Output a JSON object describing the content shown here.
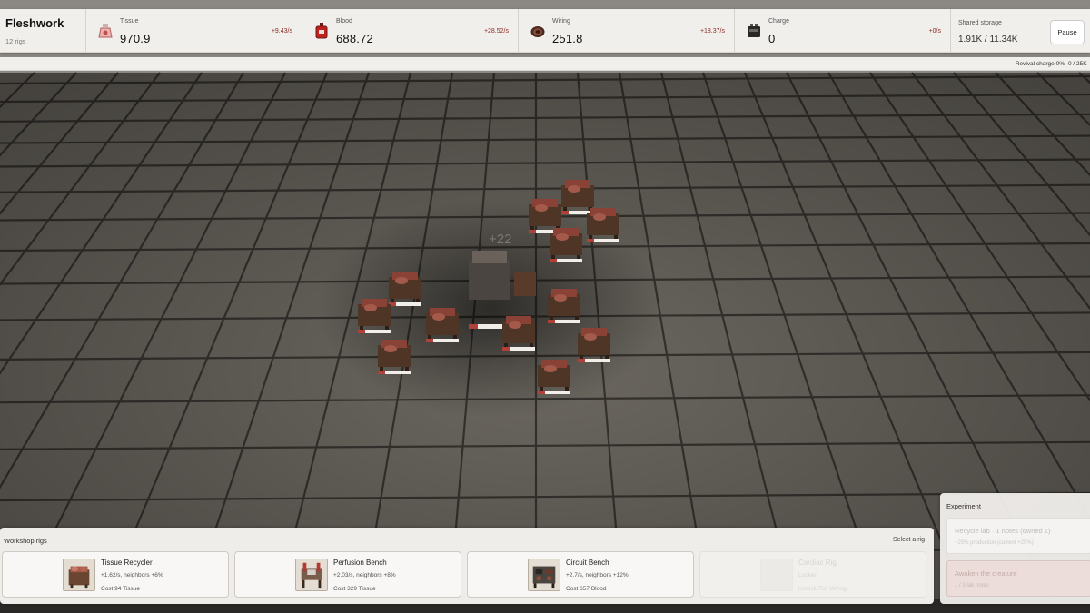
{
  "header": {
    "title": "Fleshwork",
    "rig_count": "12 rigs"
  },
  "resources": [
    {
      "name": "Tissue",
      "value": "970.9",
      "rate": "+9.43/s",
      "icon": "tissue-flask-icon"
    },
    {
      "name": "Blood",
      "value": "688.72",
      "rate": "+28.52/s",
      "icon": "blood-bag-icon"
    },
    {
      "name": "Wiring",
      "value": "251.8",
      "rate": "+18.37/s",
      "icon": "wiring-coil-icon"
    },
    {
      "name": "Charge",
      "value": "0",
      "rate": "+0/s",
      "icon": "battery-icon"
    }
  ],
  "storage": {
    "label": "Shared storage",
    "value": "1.91K / 11.34K"
  },
  "pause_label": "Pause",
  "revival": {
    "label": "Revival charge 0%",
    "count": "0 / 25K"
  },
  "scene": {
    "floating_text": "+22"
  },
  "workshop": {
    "title": "Workshop rigs",
    "hint": "Select a rig",
    "rigs": [
      {
        "name": "Tissue Recycler",
        "stat": "+1.62/s, neighbors +6%",
        "cost": "Cost 94 Tissue",
        "locked": false
      },
      {
        "name": "Perfusion Bench",
        "stat": "+2.03/s, neighbors +8%",
        "cost": "Cost 329 Tissue",
        "locked": false
      },
      {
        "name": "Circuit Bench",
        "stat": "+2.7/s, neighbors +12%",
        "cost": "Cost 657 Blood",
        "locked": false
      },
      {
        "name": "Cardiac Rig",
        "stat": "Locked",
        "cost": "Unlock 750 Wiring",
        "locked": true
      }
    ]
  },
  "experiment": {
    "title": "Experiment",
    "recycle": {
      "label": "Recycle lab · 1 notes (owned 1)",
      "sub": "+25% production (current +25%)"
    },
    "awaken": {
      "label": "Awaken the creature",
      "sub": "1 / 3 lab notes"
    }
  },
  "colors": {
    "panel": "#f1efec",
    "rate_red": "#8a2a24",
    "floor": "#6e6a63",
    "rig_wood": "#5a3a2a",
    "flesh": "#9a4a3c"
  }
}
